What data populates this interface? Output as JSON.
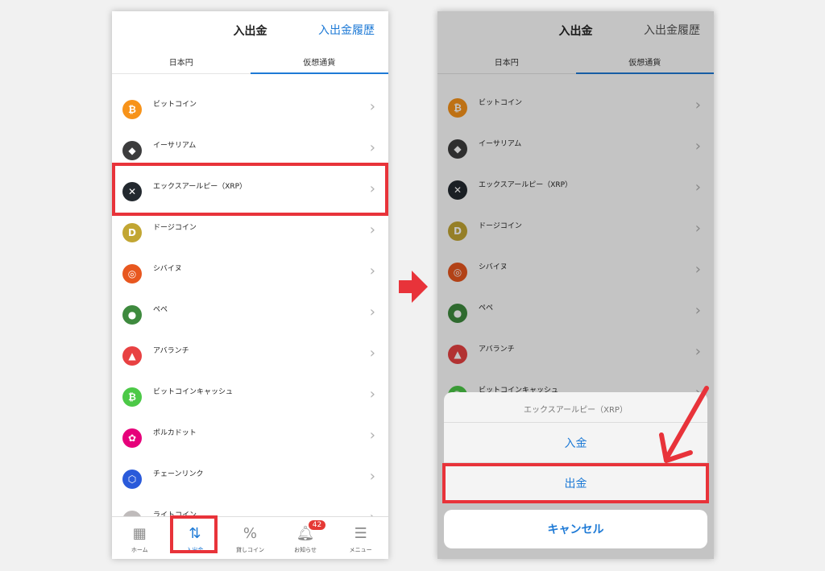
{
  "header": {
    "title": "入出金",
    "history_link": "入出金履歴"
  },
  "tabs": {
    "jpy": "日本円",
    "crypto": "仮想通貨"
  },
  "coins": [
    {
      "name": "ビットコイン",
      "icon": "bitcoin-icon",
      "color": "#f7931a",
      "glyph": "₿"
    },
    {
      "name": "イーサリアム",
      "icon": "ethereum-icon",
      "color": "#3c3c3d",
      "glyph": "◆"
    },
    {
      "name": "エックスアールピー（XRP）",
      "icon": "xrp-icon",
      "color": "#23292f",
      "glyph": "✕"
    },
    {
      "name": "ドージコイン",
      "icon": "dogecoin-icon",
      "color": "#c2a633",
      "glyph": "D"
    },
    {
      "name": "シバイヌ",
      "icon": "shiba-icon",
      "color": "#e8571f",
      "glyph": "◎"
    },
    {
      "name": "ペペ",
      "icon": "pepe-icon",
      "color": "#3e8a3e",
      "glyph": "●"
    },
    {
      "name": "アバランチ",
      "icon": "avalanche-icon",
      "color": "#e84142",
      "glyph": "▲"
    },
    {
      "name": "ビットコインキャッシュ",
      "icon": "bitcoin-cash-icon",
      "color": "#4cc947",
      "glyph": "₿"
    },
    {
      "name": "ポルカドット",
      "icon": "polkadot-icon",
      "color": "#e6007a",
      "glyph": "✿"
    },
    {
      "name": "チェーンリンク",
      "icon": "chainlink-icon",
      "color": "#2a5ada",
      "glyph": "⬡"
    },
    {
      "name": "ライトコイン",
      "icon": "litecoin-icon",
      "color": "#bfbbbb",
      "glyph": "Ł"
    }
  ],
  "tabbar": {
    "home": "ホーム",
    "deposit": "入出金",
    "lending": "貸しコイン",
    "notifications": "お知らせ",
    "notifications_badge": "42",
    "menu": "メニュー"
  },
  "sheet": {
    "title": "エックスアールピー（XRP）",
    "deposit": "入金",
    "withdraw": "出金",
    "cancel": "キャンセル"
  },
  "colors": {
    "accent": "#1e7ad6",
    "highlight": "#e8333a"
  }
}
